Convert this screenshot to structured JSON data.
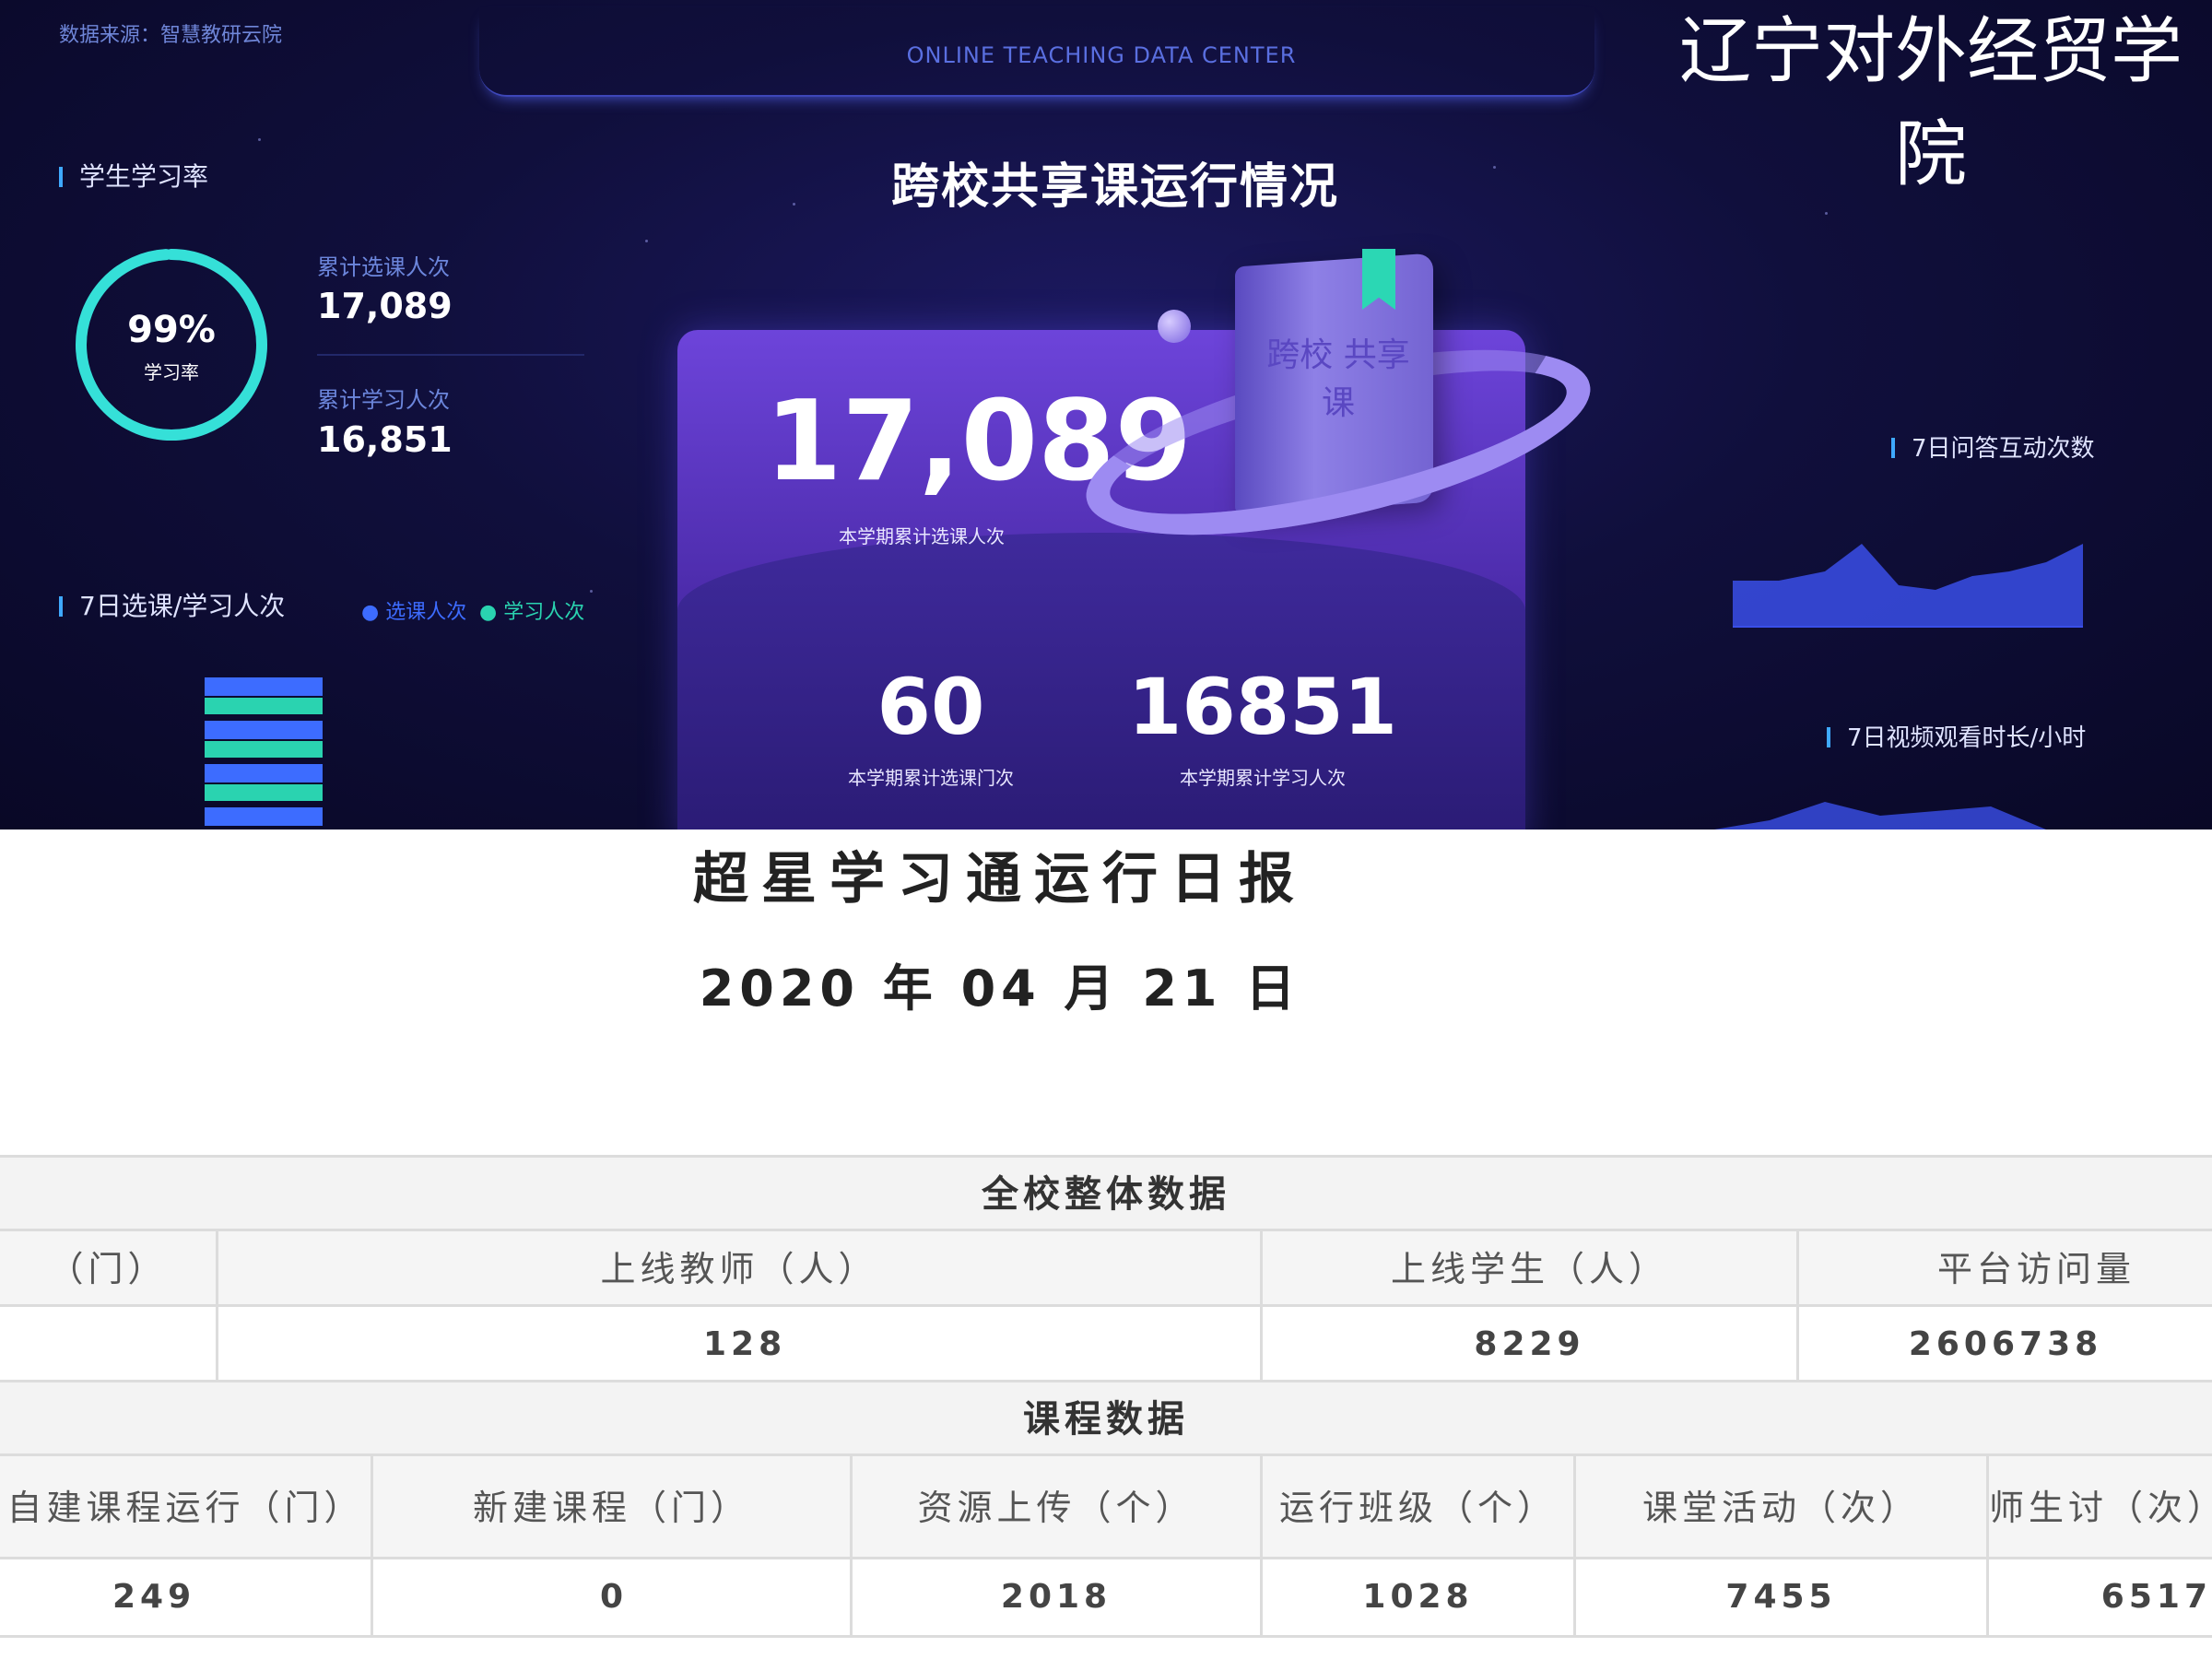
{
  "dashboard": {
    "source_label": "数据来源：智慧教研云院",
    "header_title": "ONLINE TEACHING DATA CENTER",
    "school_name": "辽宁对外经贸学院",
    "main_title": "跨校共享课运行情况",
    "study_rate": {
      "section": "学生学习率",
      "percent": "99%",
      "percent_value": 99,
      "ring_caption": "学习率",
      "enroll_label": "累计选课人次",
      "enroll_value": "17,089",
      "learn_label": "累计学习人次",
      "learn_value": "16,851"
    },
    "weekly": {
      "section": "7日选课/学习人次",
      "legend_enroll": "选课人次",
      "legend_learn": "学习人次"
    },
    "hero": {
      "main_value": "17,089",
      "main_caption": "本学期累计选课人次",
      "courses_value": "60",
      "courses_caption": "本学期累计选课门次",
      "learners_value": "16851",
      "learners_caption": "本学期累计学习人次",
      "book_text": "跨校 共享课"
    },
    "qa_section": "7日问答互动次数",
    "video_section": "7日视频观看时长/小时",
    "colors": {
      "accent_cyan": "#35e0d8",
      "bar_blue": "#3d6cff",
      "bar_green": "#2ad3b0",
      "area_blue": "#3a4fe8"
    }
  },
  "report": {
    "title": "超星学习通运行日报",
    "date": "2020 年 04 月 21 日",
    "school_section": "全校整体数据",
    "school_headers": [
      "（门）",
      "上线教师（人）",
      "上线学生（人）",
      "平台访问量"
    ],
    "school_values": [
      "",
      "128",
      "8229",
      "2606738"
    ],
    "course_section": "课程数据",
    "course_headers": [
      "自建课程运行（门）",
      "新建课程（门）",
      "资源上传（个）",
      "运行班级（个）",
      "课堂活动（次）",
      "师生讨（次）"
    ],
    "course_values": [
      "249",
      "0",
      "2018",
      "1028",
      "7455",
      "6517"
    ]
  }
}
